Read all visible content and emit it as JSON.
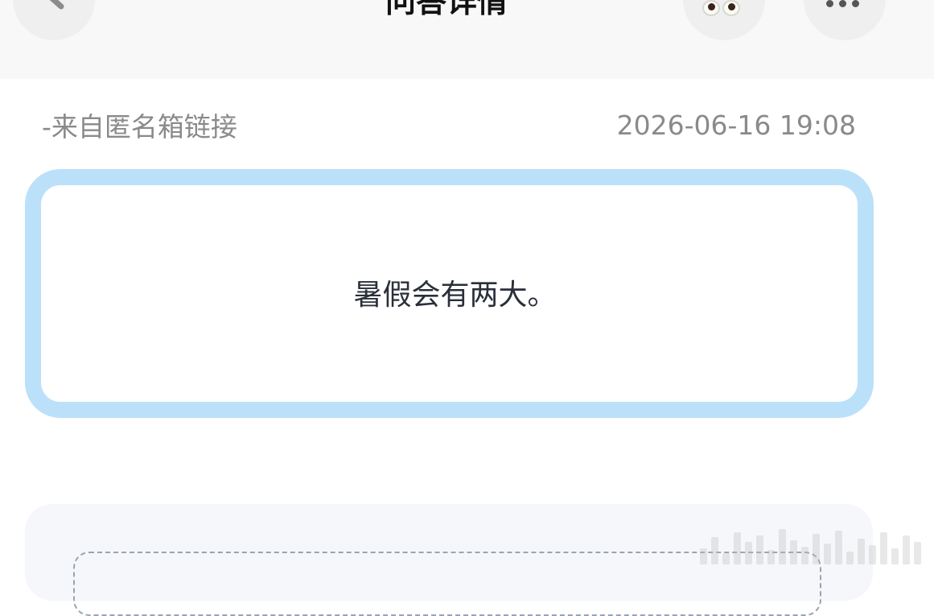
{
  "header": {
    "title": "问答详情",
    "back_icon": "chevron-left-icon",
    "eyes_icon": "eyes-emoji-icon",
    "more_icon": "more-dots-icon"
  },
  "question": {
    "source": "-来自匿名箱链接",
    "timestamp": "2026-06-16 19:08",
    "text": "暑假会有两大。",
    "border_color": "#bbe0fa"
  },
  "colors": {
    "header_bg": "#f8f8f8",
    "meta_text": "#8a8a8a",
    "question_text": "#2a2f3a",
    "answer_bg": "#f5f7fa"
  }
}
